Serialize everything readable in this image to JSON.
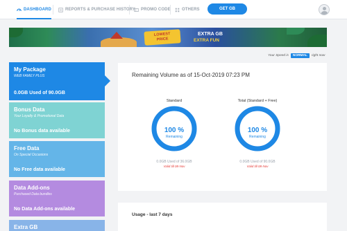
{
  "nav": {
    "dashboard": "DASHBOARD",
    "reports": "REPORTS & PURCHASE HISTORY",
    "promo": "PROMO CODE",
    "others": "OTHERS",
    "get_gb": "GET GB"
  },
  "banner": {
    "badge_line1": "LOWEST",
    "badge_line2": "PRICE",
    "line1": "EXTRA GB",
    "line2": "EXTRA FUN"
  },
  "speed": {
    "prefix": "Your Speed is",
    "value": "NORMAL",
    "suffix": "right now"
  },
  "sidebar": {
    "package": {
      "title": "My Package",
      "subtitle": "WEB FAMILY PLUS",
      "value": "0.0GB Used of 90.0GB"
    },
    "bonus": {
      "title": "Bonus Data",
      "subtitle": "Your Loyalty & Promotional Data",
      "value": "No Bonus data available"
    },
    "free": {
      "title": "Free Data",
      "subtitle": "On Special Occasions",
      "value": "No Free data available"
    },
    "addons": {
      "title": "Data Add-ons",
      "subtitle": "Purchased Data bundles",
      "value": "No Data Add-ons available"
    },
    "extra": {
      "title": "Extra GB"
    }
  },
  "main": {
    "title": "Remaining Volume as of 15-Oct-2019 07:23 PM",
    "standard": {
      "label": "Standard",
      "percent": "100 %",
      "remaining": "Remaining",
      "used": "0.0GB Used of 36.0GB",
      "valid": "Valid till 08-Nov",
      "fraction": 1.0
    },
    "total": {
      "label": "Total (Standard + Free)",
      "percent": "100 %",
      "remaining": "Remaining",
      "used": "0.0GB Used of 90.0GB",
      "valid": "Valid till 08-Nov",
      "fraction": 1.0
    }
  },
  "usage": {
    "title": "Usage - last 7 days"
  },
  "colors": {
    "accent": "#1e88e5",
    "bonus": "#7fd3d3",
    "free": "#64b5e8",
    "addons": "#b48be0",
    "alert": "#e53935"
  }
}
